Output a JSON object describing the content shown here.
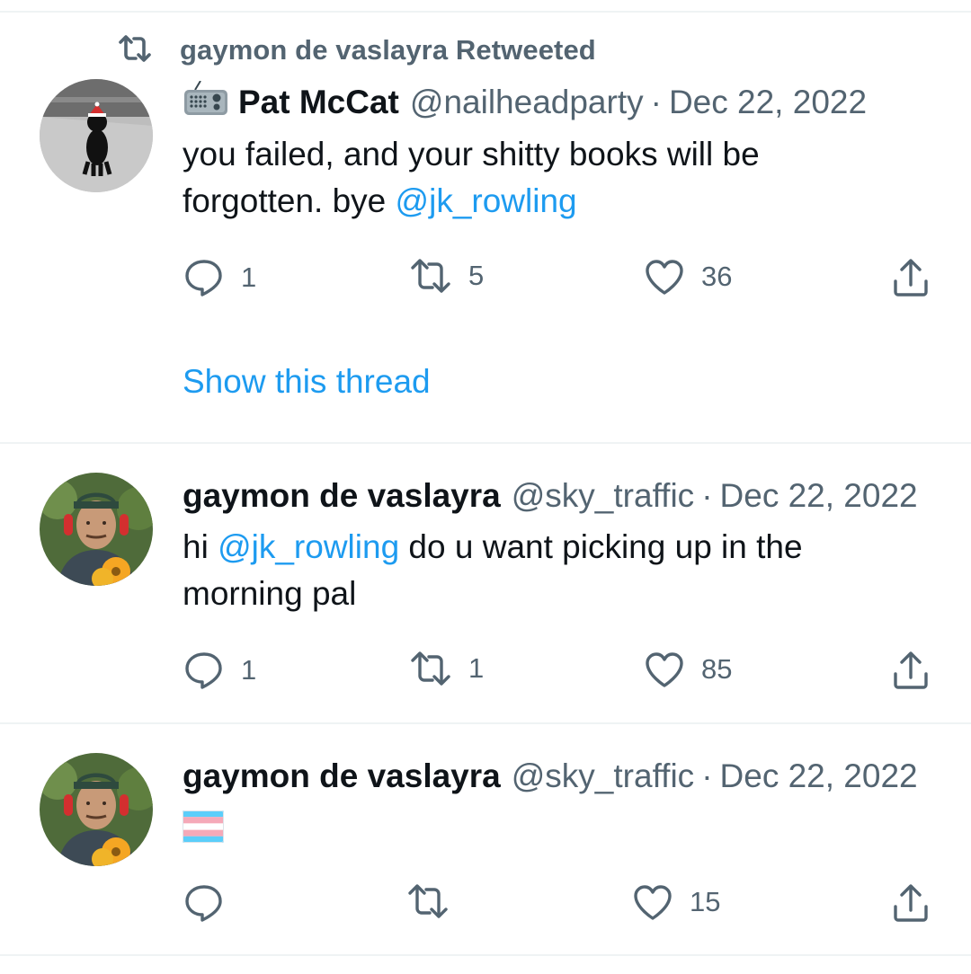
{
  "retweet_banner": {
    "text": "gaymon de vaslayra Retweeted"
  },
  "tweets": [
    {
      "name": "Pat McCat",
      "handle": "@nailheadparty",
      "separator": "·",
      "date": "Dec 22, 2022",
      "text_before": "you failed, and your shitty books will be forgotten. bye ",
      "mention": "@jk_rowling",
      "text_after": "",
      "replies": "1",
      "retweets": "5",
      "likes": "36",
      "show_thread": "Show this thread",
      "name_emoji": "radio-icon"
    },
    {
      "name": "gaymon de vaslayra",
      "handle": "@sky_traffic",
      "separator": "·",
      "date": "Dec 22, 2022",
      "text_before": "hi ",
      "mention": "@jk_rowling",
      "text_after": " do u want picking up in the morning pal",
      "replies": "1",
      "retweets": "1",
      "likes": "85"
    },
    {
      "name": "gaymon de vaslayra",
      "handle": "@sky_traffic",
      "separator": "·",
      "date": "Dec 22, 2022",
      "body_emoji": "transgender-flag-icon",
      "replies": "",
      "retweets": "",
      "likes": "15"
    }
  ],
  "colors": {
    "text_primary": "#0f1419",
    "text_secondary": "#536471",
    "link": "#1d9bf0",
    "divider": "#eff3f4"
  }
}
